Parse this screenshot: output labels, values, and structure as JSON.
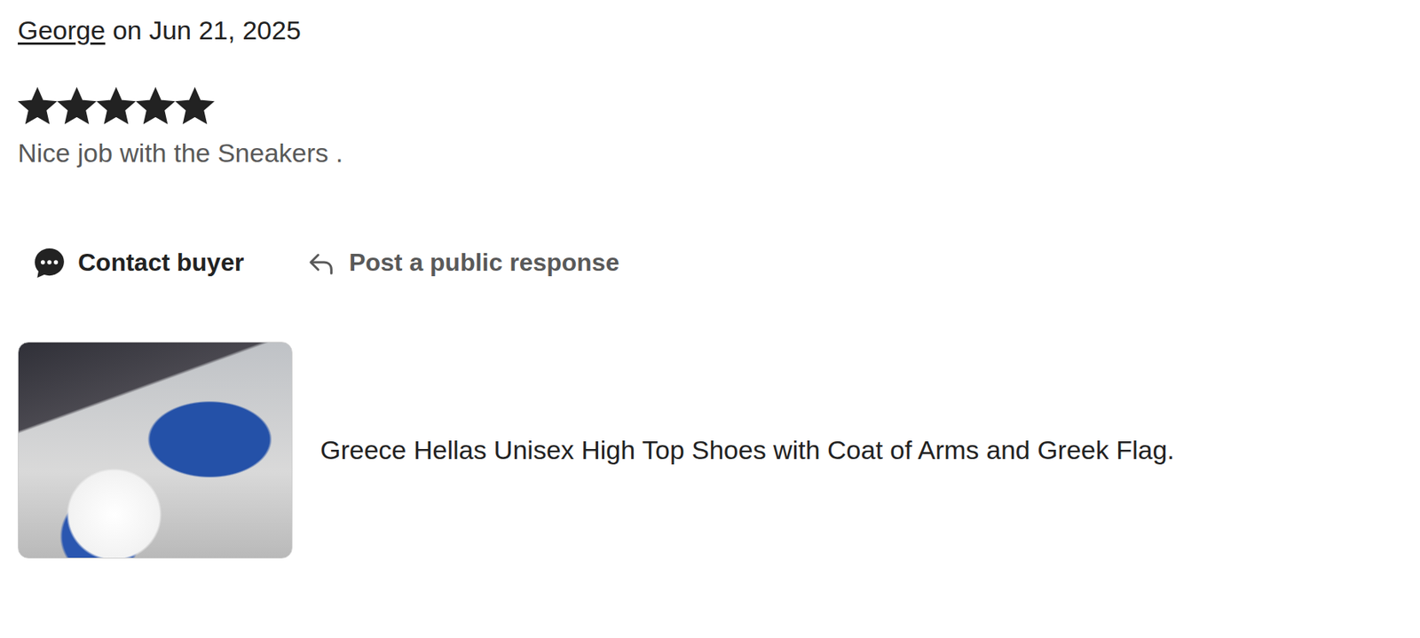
{
  "reviewer": {
    "name": "George",
    "date": "on Jun 21, 2025"
  },
  "review": {
    "stars": 5,
    "text": "Nice job with the Sneakers ."
  },
  "actions": [
    {
      "label": "Contact buyer"
    },
    {
      "label": "Post a public response"
    }
  ],
  "product": {
    "title": "Greece Hellas Unisex High Top Shoes with Coat of Arms and Greek Flag."
  }
}
